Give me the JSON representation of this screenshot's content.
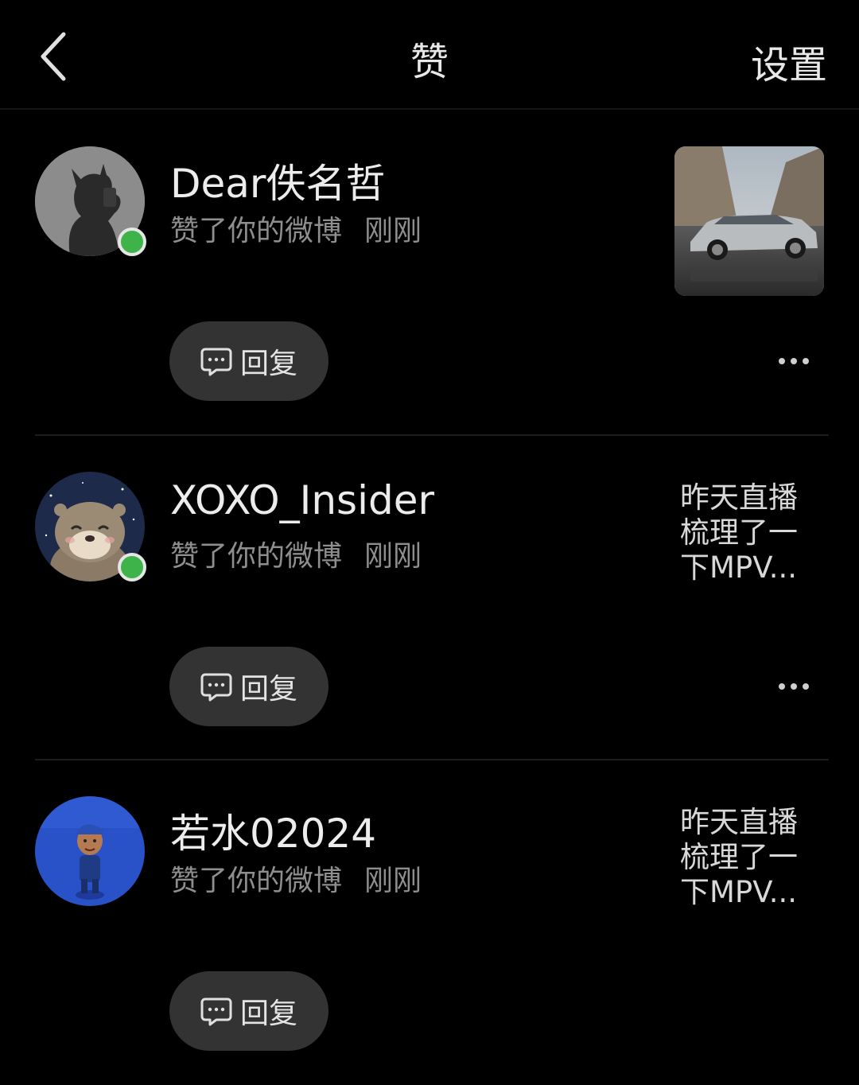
{
  "header": {
    "title": "赞",
    "settings_label": "设置",
    "back_icon": "chevron-left-icon"
  },
  "items": [
    {
      "name": "Dear佚名哲",
      "action": "赞了你的微博",
      "time": "刚刚",
      "online": true,
      "preview_type": "image",
      "preview_text": "",
      "reply_label": "回复"
    },
    {
      "name": "XOXO_Insider",
      "action": "赞了你的微博",
      "time": "刚刚",
      "online": true,
      "preview_type": "text",
      "preview_text": "昨天直播梳理了一下MPV...",
      "reply_label": "回复"
    },
    {
      "name": "若水02024",
      "action": "赞了你的微博",
      "time": "刚刚",
      "online": false,
      "preview_type": "text",
      "preview_text": "昨天直播梳理了一下MPV...",
      "reply_label": "回复"
    }
  ],
  "colors": {
    "background": "#000000",
    "online_dot": "#3db34a",
    "reply_button": "#333333",
    "secondary_text": "#8e8e8e"
  }
}
